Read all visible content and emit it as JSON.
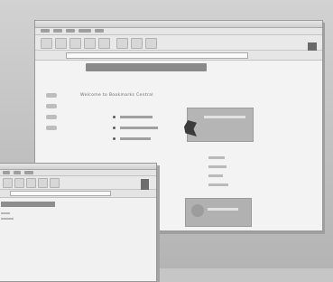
{
  "back_window": {
    "page_title": "Welcome to Bookmarks Central"
  },
  "caption": ""
}
